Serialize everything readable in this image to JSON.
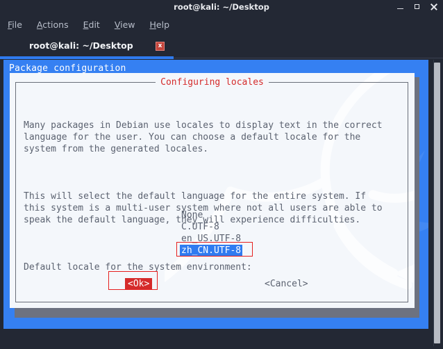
{
  "window": {
    "title": "root@kali: ~/Desktop",
    "controls": {
      "minimize": "minimize-icon",
      "maximize": "maximize-icon",
      "close": "close-icon"
    }
  },
  "menubar": {
    "items": [
      {
        "label": "File",
        "mnemonic": "F",
        "rest": "ile"
      },
      {
        "label": "Actions",
        "mnemonic": "A",
        "rest": "ctions"
      },
      {
        "label": "Edit",
        "mnemonic": "E",
        "rest": "dit"
      },
      {
        "label": "View",
        "mnemonic": "V",
        "rest": "iew"
      },
      {
        "label": "Help",
        "mnemonic": "H",
        "rest": "elp"
      }
    ]
  },
  "tabbar": {
    "tabs": [
      {
        "label": "root@kali: ~/Desktop",
        "close_label": "x",
        "active": true
      }
    ]
  },
  "terminal": {
    "header": "Package configuration",
    "background_color": "#3580f2"
  },
  "dialog": {
    "title": "Configuring locales",
    "title_color": "#d52b2b",
    "paragraphs": [
      "Many packages in Debian use locales to display text in the correct\nlanguage for the user. You can choose a default locale for the\nsystem from the generated locales.",
      "This will select the default language for the entire system. If\nthis system is a multi-user system where not all users are able to\nspeak the default language, they will experience difficulties.",
      "Default locale for the system environment:"
    ],
    "locales": [
      {
        "label": "None",
        "selected": false
      },
      {
        "label": "C.UTF-8",
        "selected": false
      },
      {
        "label": "en_US.UTF-8",
        "selected": false
      },
      {
        "label": "zh_CN.UTF-8",
        "selected": true
      }
    ],
    "buttons": {
      "ok": "<Ok>",
      "cancel": "<Cancel>"
    },
    "selection_color": "#2f7bf0",
    "annotation_color": "#e5201f"
  },
  "scrollbar": {
    "thumb_label": "vertical-scroll-thumb"
  }
}
